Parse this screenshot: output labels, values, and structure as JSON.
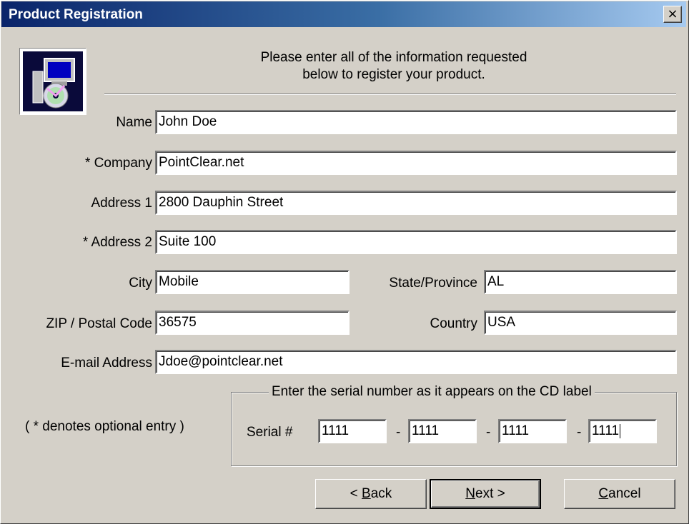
{
  "window": {
    "title": "Product Registration",
    "close_glyph": "×"
  },
  "intro": "Please enter all of the information requested\nbelow to register your product.",
  "fields": {
    "name": {
      "label": "Name",
      "value": "John Doe"
    },
    "company": {
      "label": "* Company",
      "value": "PointClear.net"
    },
    "address1": {
      "label": "Address 1",
      "value": "2800 Dauphin Street"
    },
    "address2": {
      "label": "* Address 2",
      "value": "Suite 100"
    },
    "city": {
      "label": "City",
      "value": "Mobile"
    },
    "state": {
      "label": "State/Province",
      "value": "AL"
    },
    "zip": {
      "label": "ZIP / Postal Code",
      "value": "36575"
    },
    "country": {
      "label": "Country",
      "value": "USA"
    },
    "email": {
      "label": "E-mail Address",
      "value": "Jdoe@pointclear.net"
    }
  },
  "optional_note": "( * denotes optional entry )",
  "serial": {
    "group_title": "Enter the serial number as it appears on the CD label",
    "label": "Serial #",
    "separator": "-",
    "parts": [
      "1111",
      "1111",
      "1111",
      "1111"
    ]
  },
  "buttons": {
    "back_pre": "< ",
    "back_key": "B",
    "back_post": "ack",
    "next_key": "N",
    "next_post": "ext >",
    "cancel_key": "C",
    "cancel_post": "ancel"
  },
  "icons": {
    "app": "setup-computer-cd-icon",
    "close": "close-icon"
  }
}
